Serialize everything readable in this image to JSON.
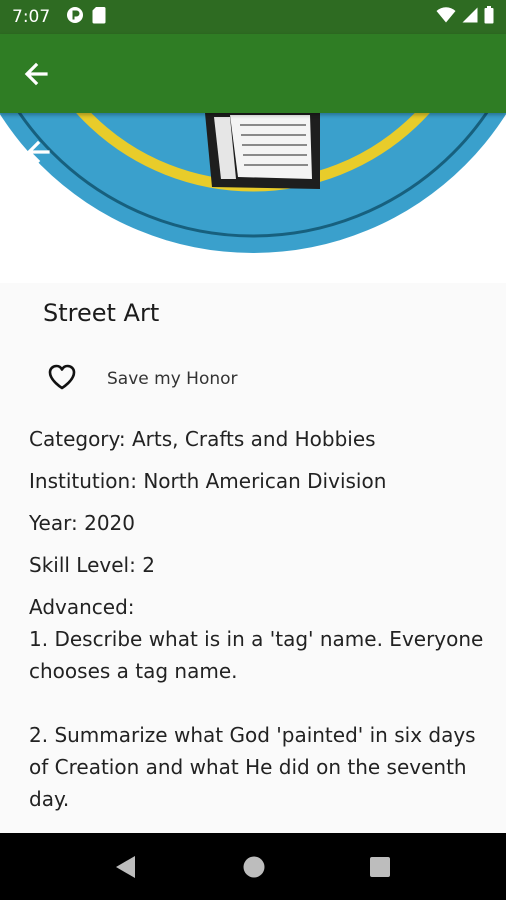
{
  "status_bar": {
    "time": "7:07",
    "icons": [
      "notification-icon",
      "sd-card-icon",
      "wifi-icon",
      "signal-icon",
      "battery-icon"
    ]
  },
  "app_bar": {
    "back_icon": "arrow-back-icon",
    "color": "#2f7d24"
  },
  "honor": {
    "title": "Street Art",
    "save_label": "Save my Honor",
    "favorite_icon": "heart-outline-icon",
    "category": "Category: Arts, Crafts and Hobbies",
    "institution": "Institution: North American Division",
    "year": "Year: 2020",
    "skill_level": "Skill Level: 2",
    "requirements": "Advanced:\n1. Describe what is in a 'tag' name. Everyone chooses a tag name.\n\n2. Summarize what God 'painted' in six days of Creation and what He did on the seventh day."
  },
  "nav_bar": {
    "icons": [
      "nav-back-icon",
      "nav-home-icon",
      "nav-recents-icon"
    ]
  }
}
